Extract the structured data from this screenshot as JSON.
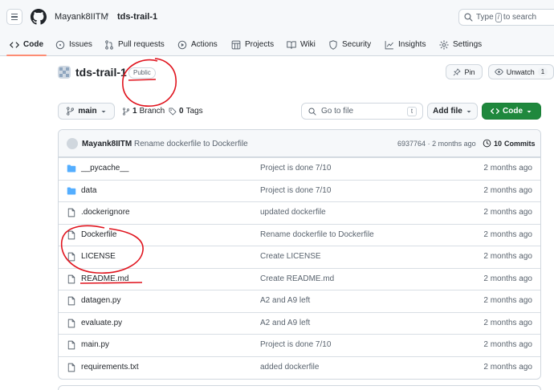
{
  "header": {
    "owner": "Mayank8IITM",
    "separator": "/",
    "repo": "tds-trail-1",
    "search_prefix": "Type",
    "search_key": "/",
    "search_suffix": "to search"
  },
  "tabs": [
    {
      "label": "Code",
      "icon": "code-icon"
    },
    {
      "label": "Issues",
      "icon": "issue-icon"
    },
    {
      "label": "Pull requests",
      "icon": "pull-request-icon"
    },
    {
      "label": "Actions",
      "icon": "play-icon"
    },
    {
      "label": "Projects",
      "icon": "table-icon"
    },
    {
      "label": "Wiki",
      "icon": "book-icon"
    },
    {
      "label": "Security",
      "icon": "shield-icon"
    },
    {
      "label": "Insights",
      "icon": "graph-icon"
    },
    {
      "label": "Settings",
      "icon": "gear-icon"
    }
  ],
  "repo_header": {
    "name": "tds-trail-1",
    "visibility": "Public",
    "pin_label": "Pin",
    "watch_label": "Unwatch",
    "watch_count": "1"
  },
  "toolbar": {
    "branch": "main",
    "branches_count": "1",
    "branches_label": "Branch",
    "tags_count": "0",
    "tags_label": "Tags",
    "goto_placeholder": "Go to file",
    "goto_key": "t",
    "add_file_label": "Add file",
    "code_label": "Code"
  },
  "latest_commit": {
    "author": "Mayank8IITM",
    "message": "Rename dockerfile to Dockerfile",
    "hash": "6937764",
    "dot": "·",
    "age": "2 months ago",
    "commits_count": "10",
    "commits_label": "Commits"
  },
  "files": [
    {
      "name": "__pycache__",
      "type": "folder",
      "message": "Project is done 7/10",
      "age": "2 months ago"
    },
    {
      "name": "data",
      "type": "folder",
      "message": "Project is done 7/10",
      "age": "2 months ago"
    },
    {
      "name": ".dockerignore",
      "type": "file",
      "message": "updated dockerfile",
      "age": "2 months ago"
    },
    {
      "name": "Dockerfile",
      "type": "file",
      "message": "Rename dockerfile to Dockerfile",
      "age": "2 months ago"
    },
    {
      "name": "LICENSE",
      "type": "file",
      "message": "Create LICENSE",
      "age": "2 months ago"
    },
    {
      "name": "README.md",
      "type": "file",
      "message": "Create README.md",
      "age": "2 months ago"
    },
    {
      "name": "datagen.py",
      "type": "file",
      "message": "A2 and A9 left",
      "age": "2 months ago"
    },
    {
      "name": "evaluate.py",
      "type": "file",
      "message": "A2 and A9 left",
      "age": "2 months ago"
    },
    {
      "name": "main.py",
      "type": "file",
      "message": "Project is done 7/10",
      "age": "2 months ago"
    },
    {
      "name": "requirements.txt",
      "type": "file",
      "message": "added dockerfile",
      "age": "2 months ago"
    }
  ],
  "colors": {
    "accent_underline": "#fd8c73",
    "code_button": "#1f883d",
    "folder": "#54aeff",
    "annotation_red": "#e0141e"
  }
}
